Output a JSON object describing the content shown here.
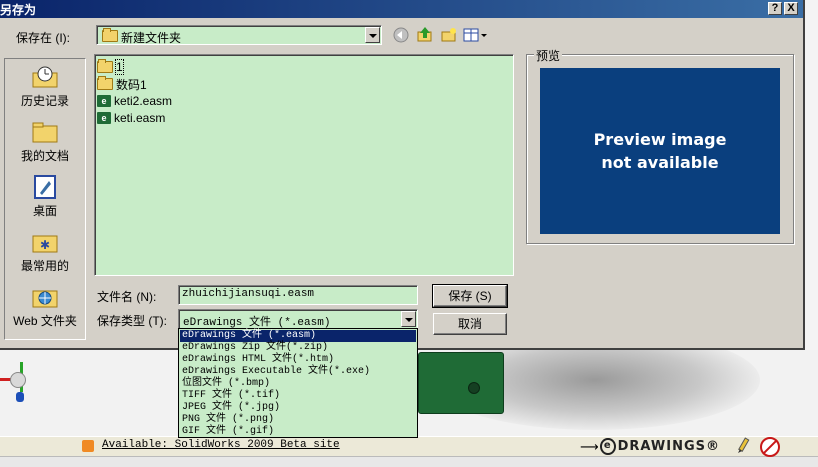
{
  "dialog": {
    "title": "另存为",
    "help_btn": "?",
    "close_btn": "X",
    "save_in_label": "保存在 (I):",
    "save_in_value": "新建文件夹",
    "preview_label": "预览",
    "preview_text_line1": "Preview image",
    "preview_text_line2": "not available",
    "filename_label": "文件名 (N):",
    "filename_value": "zhuichijiansuqi.easm",
    "filetype_label": "保存类型 (T):",
    "filetype_value": "eDrawings 文件 (*.easm)",
    "save_button": "保存 (S)",
    "cancel_button": "取消"
  },
  "places": [
    {
      "label": "历史记录",
      "icon": "history-icon"
    },
    {
      "label": "我的文档",
      "icon": "my-documents-icon"
    },
    {
      "label": "桌面",
      "icon": "desktop-icon"
    },
    {
      "label": "最常用的",
      "icon": "favorites-icon"
    },
    {
      "label": "Web 文件夹",
      "icon": "web-folder-icon"
    }
  ],
  "files": [
    {
      "name": "1",
      "icon": "folder-icon"
    },
    {
      "name": "数码1",
      "icon": "folder-icon"
    },
    {
      "name": "keti2.easm",
      "icon": "easm-file-icon"
    },
    {
      "name": "keti.easm",
      "icon": "easm-file-icon"
    }
  ],
  "filetype_options": [
    "eDrawings 文件 (*.easm)",
    "eDrawings Zip 文件(*.zip)",
    "eDrawings HTML 文件(*.htm)",
    "eDrawings Executable 文件(*.exe)",
    "位图文件 (*.bmp)",
    "TIFF 文件 (*.tif)",
    "JPEG 文件 (*.jpg)",
    "PNG 文件 (*.png)",
    "GIF 文件 (*.gif)"
  ],
  "status": {
    "link_text": "Available: SolidWorks 2009 Beta site",
    "logo_text": "DRAWINGS®",
    "logo_e": "e"
  },
  "colors": {
    "list_bg": "#c8ecc8",
    "title_bar": "#0a246a",
    "preview_bg": "#0a3f7e",
    "selection": "#0a246a"
  }
}
